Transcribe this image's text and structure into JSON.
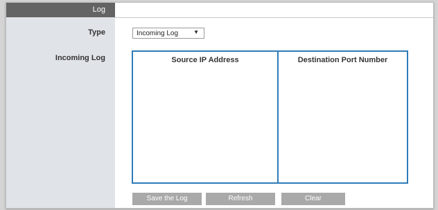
{
  "sidebar": {
    "header": "Log",
    "type_label": "Type",
    "incoming_log_label": "Incoming Log"
  },
  "type_select": {
    "selected": "Incoming Log",
    "arrow_icon": "dropdown-arrow-icon"
  },
  "table": {
    "columns": [
      "Source IP Address",
      "Destination Port Number"
    ],
    "rows": []
  },
  "buttons": {
    "save_log": "Save the Log",
    "refresh": "Refresh",
    "clear": "Clear"
  },
  "colors": {
    "sidebar_header": "#646464",
    "sidebar_bg": "#e0e3e8",
    "table_border": "#2d7bb8",
    "button_bg": "#a9a9a9"
  }
}
